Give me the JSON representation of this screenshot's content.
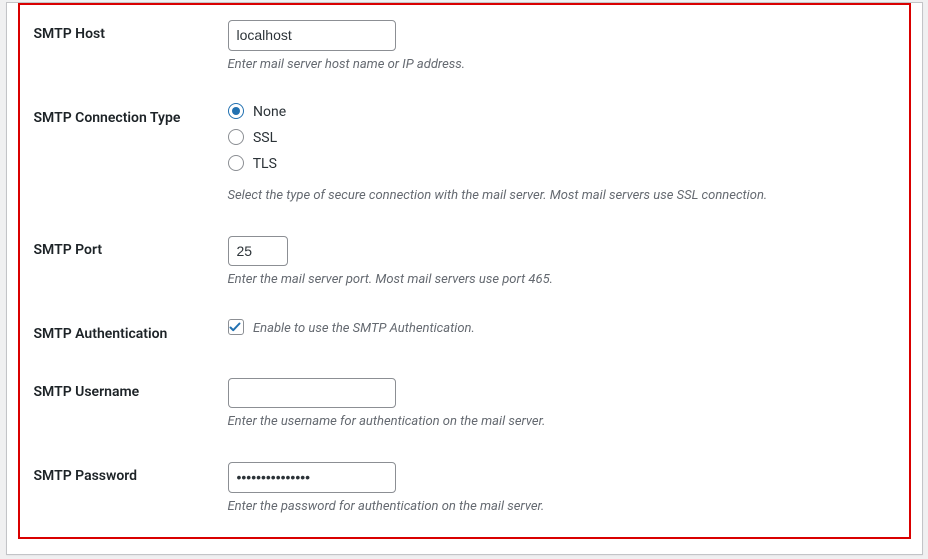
{
  "smtp_host": {
    "label": "SMTP Host",
    "value": "localhost",
    "description": "Enter mail server host name or IP address."
  },
  "smtp_connection_type": {
    "label": "SMTP Connection Type",
    "options": {
      "none": "None",
      "ssl": "SSL",
      "tls": "TLS"
    },
    "selected": "none",
    "description": "Select the type of secure connection with the mail server. Most mail servers use SSL connection."
  },
  "smtp_port": {
    "label": "SMTP Port",
    "value": "25",
    "description": "Enter the mail server port. Most mail servers use port 465."
  },
  "smtp_auth": {
    "label": "SMTP Authentication",
    "checked": true,
    "checkbox_label": "Enable to use the SMTP Authentication."
  },
  "smtp_username": {
    "label": "SMTP Username",
    "value": "",
    "description": "Enter the username for authentication on the mail server."
  },
  "smtp_password": {
    "label": "SMTP Password",
    "value": "•••••••••••••••",
    "description": "Enter the password for authentication on the mail server."
  }
}
